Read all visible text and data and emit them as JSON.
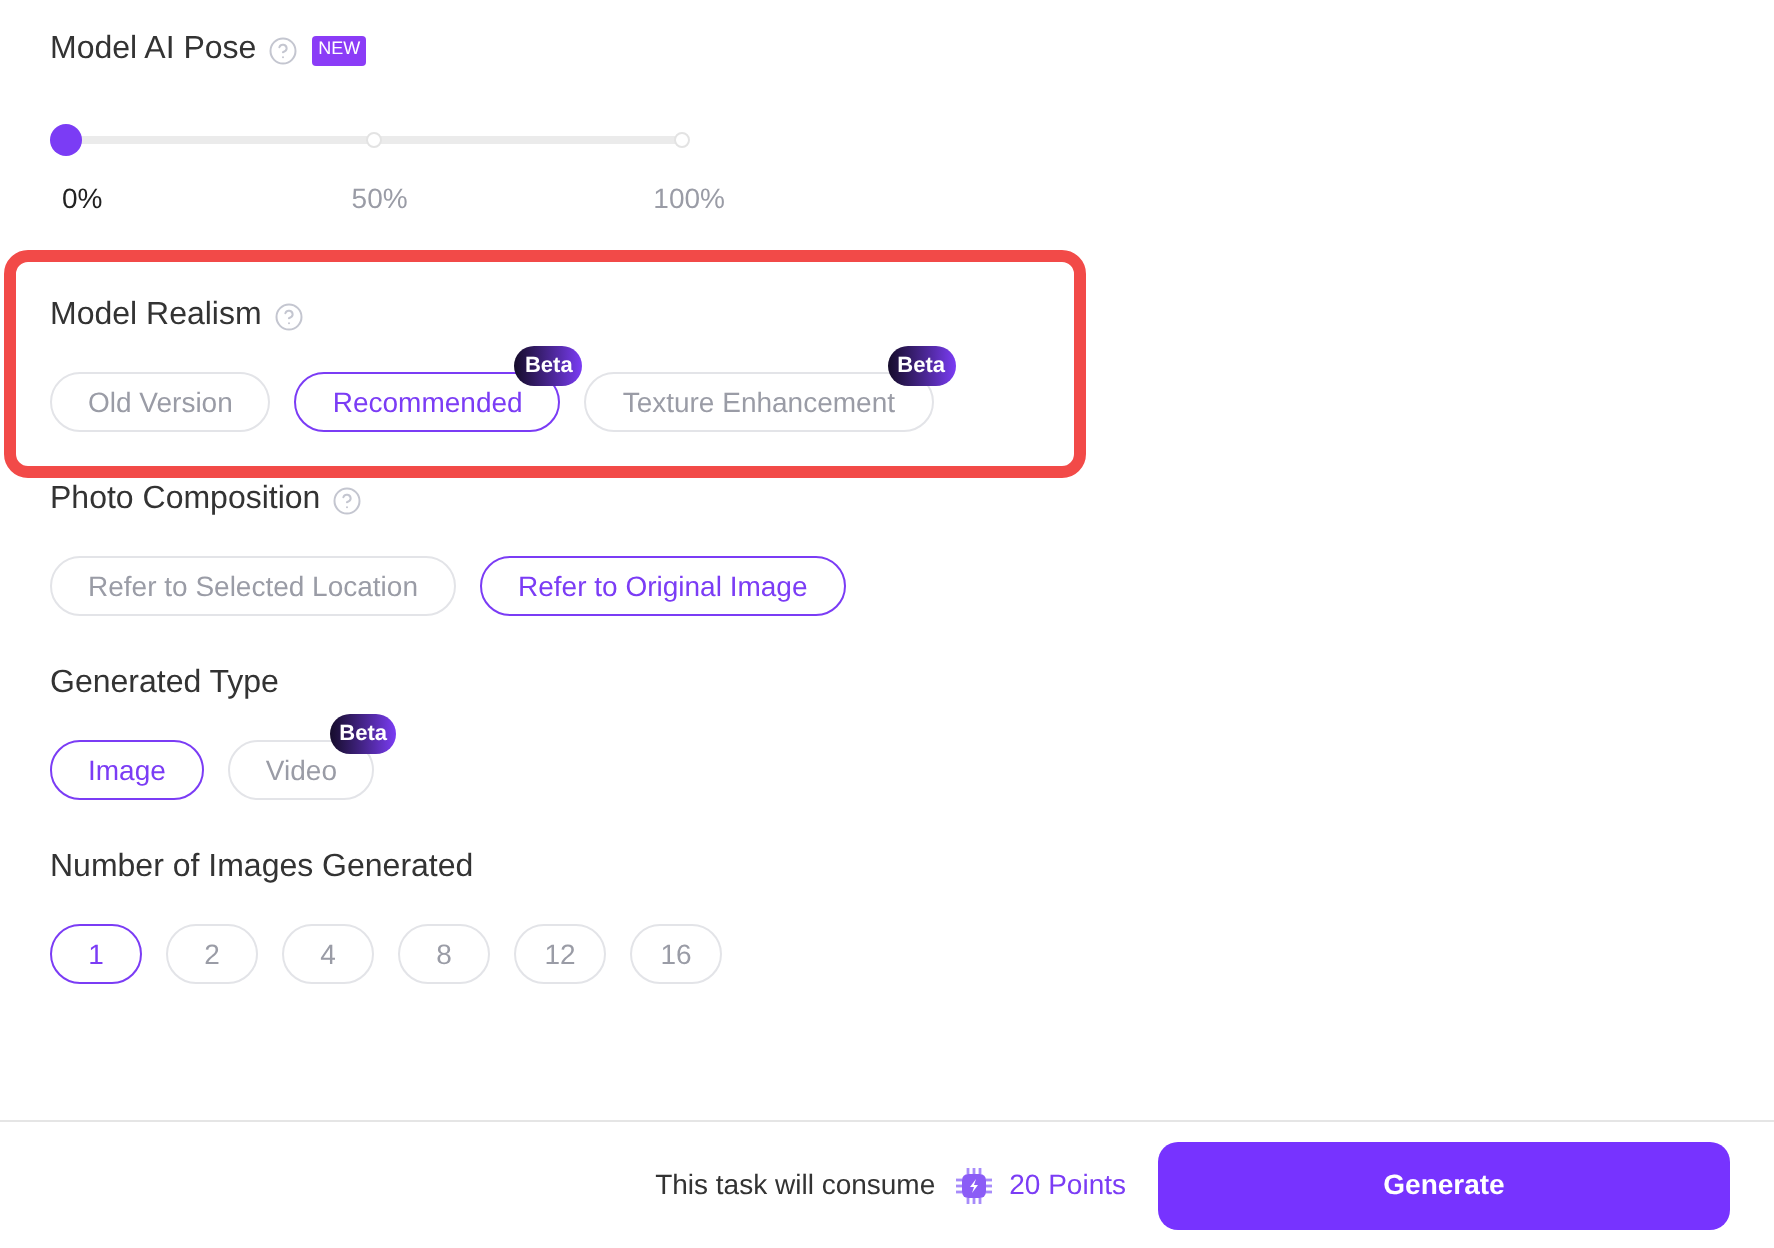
{
  "pose": {
    "title": "Model AI Pose",
    "badge": "NEW",
    "level": 0,
    "ticks": [
      {
        "label": "0%",
        "selected": true
      },
      {
        "label": "50%",
        "selected": false
      },
      {
        "label": "100%",
        "selected": false
      }
    ]
  },
  "sections": [
    {
      "title": "Model Realism",
      "help": true,
      "highlighted": true,
      "kind": "pills",
      "options": [
        {
          "label": "Old Version",
          "selected": false
        },
        {
          "label": "Recommended",
          "selected": true,
          "badge": "Beta"
        },
        {
          "label": "Texture Enhancement",
          "selected": false,
          "badge": "Beta"
        }
      ]
    },
    {
      "title": "Photo Composition",
      "help": true,
      "highlighted": false,
      "kind": "pills",
      "options": [
        {
          "label": "Refer to Selected Location",
          "selected": false
        },
        {
          "label": "Refer to Original Image",
          "selected": true
        }
      ]
    },
    {
      "title": "Generated Type",
      "help": false,
      "highlighted": false,
      "kind": "pills",
      "options": [
        {
          "label": "Image",
          "selected": true
        },
        {
          "label": "Video",
          "selected": false,
          "badge": "Beta"
        }
      ]
    },
    {
      "title": "Number of Images Generated",
      "help": false,
      "highlighted": false,
      "kind": "numbers",
      "options": [
        {
          "label": "1",
          "selected": true
        },
        {
          "label": "2",
          "selected": false
        },
        {
          "label": "4",
          "selected": false
        },
        {
          "label": "8",
          "selected": false
        },
        {
          "label": "12",
          "selected": false
        },
        {
          "label": "16",
          "selected": false
        }
      ]
    }
  ],
  "footer": {
    "cost_text": "This task will consume",
    "points": "20 Points",
    "button": "Generate"
  }
}
